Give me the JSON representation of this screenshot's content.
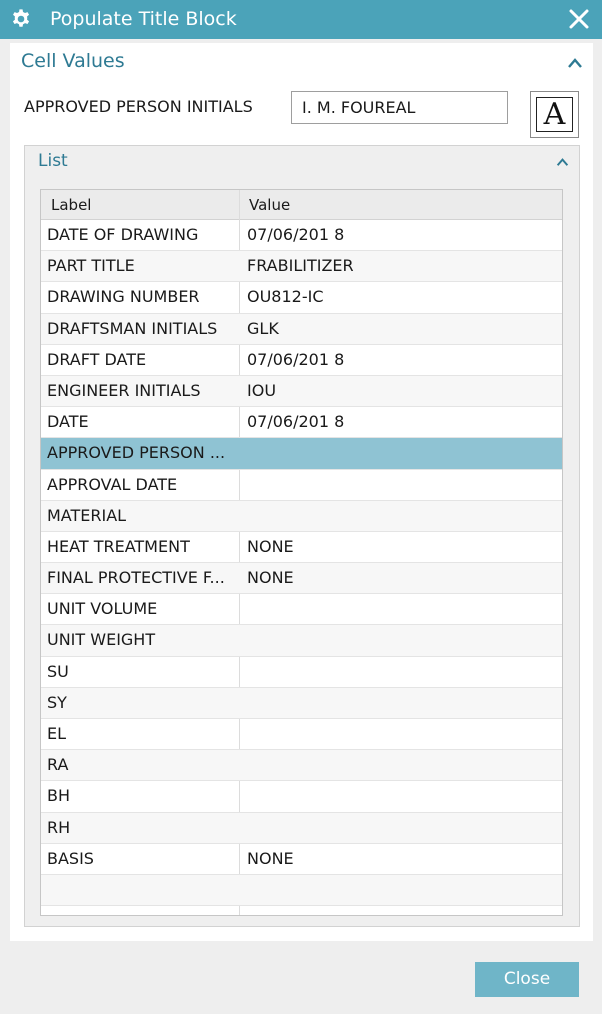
{
  "window": {
    "title": "Populate Title Block"
  },
  "cell_values": {
    "section_title": "Cell Values",
    "field_label": "APPROVED PERSON INITIALS",
    "field_value": "I. M. FOUREAL",
    "font_button_glyph": "A"
  },
  "list": {
    "title": "List",
    "columns": [
      "Label",
      "Value"
    ],
    "selected_index": 7,
    "rows": [
      {
        "label": "DATE OF DRAWING",
        "value": "07/06/201 8"
      },
      {
        "label": "PART TITLE",
        "value": "FRABILITIZER"
      },
      {
        "label": "DRAWING NUMBER",
        "value": "OU812-IC"
      },
      {
        "label": "DRAFTSMAN INITIALS",
        "value": "GLK"
      },
      {
        "label": "DRAFT DATE",
        "value": "07/06/201 8"
      },
      {
        "label": "ENGINEER INITIALS",
        "value": "IOU"
      },
      {
        "label": "DATE",
        "value": "07/06/201 8"
      },
      {
        "label": "APPROVED PERSON ...",
        "value": ""
      },
      {
        "label": "APPROVAL DATE",
        "value": ""
      },
      {
        "label": "MATERIAL",
        "value": ""
      },
      {
        "label": "HEAT TREATMENT",
        "value": "NONE"
      },
      {
        "label": "FINAL PROTECTIVE F...",
        "value": "NONE"
      },
      {
        "label": "UNIT VOLUME",
        "value": ""
      },
      {
        "label": "UNIT WEIGHT",
        "value": ""
      },
      {
        "label": "SU",
        "value": ""
      },
      {
        "label": "SY",
        "value": ""
      },
      {
        "label": "EL",
        "value": ""
      },
      {
        "label": "RA",
        "value": ""
      },
      {
        "label": "BH",
        "value": ""
      },
      {
        "label": "RH",
        "value": ""
      },
      {
        "label": "BASIS",
        "value": "NONE"
      },
      {
        "label": "",
        "value": ""
      }
    ]
  },
  "footer": {
    "close_label": "Close"
  },
  "colors": {
    "titlebar": "#4ba3b9",
    "accent_text": "#2e7a93",
    "selected_row": "#8fc3d3",
    "close_button": "#6fb5c8"
  }
}
